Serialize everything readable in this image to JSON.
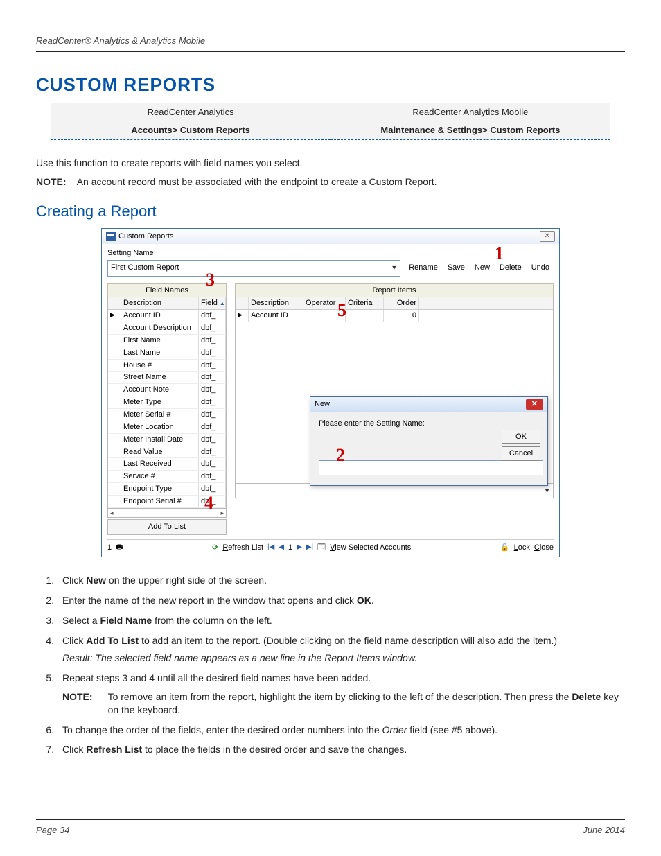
{
  "header": "ReadCenter® Analytics & Analytics Mobile",
  "title": "CUSTOM REPORTS",
  "navtable": {
    "h1": "ReadCenter Analytics",
    "h2": "ReadCenter Analytics Mobile",
    "p1": "Accounts> Custom Reports",
    "p2": "Maintenance & Settings> Custom Reports"
  },
  "intro": "Use this function to create reports with field names you select.",
  "note_label": "NOTE:",
  "note_text": "An account record must be associated with the endpoint to create a Custom Report.",
  "subtitle": "Creating a Report",
  "win": {
    "title": "Custom Reports",
    "close": "✕",
    "setting_label": "Setting Name",
    "setting_value": "First Custom Report",
    "buttons": {
      "rename": "Rename",
      "save": "Save",
      "new": "New",
      "delete": "Delete",
      "undo": "Undo"
    },
    "left_header": "Field Names",
    "right_header": "Report Items",
    "left_cols": {
      "desc": "Description",
      "field": "Field"
    },
    "left_rows": [
      {
        "d": "Account ID",
        "f": "dbf_"
      },
      {
        "d": "Account Description",
        "f": "dbf_"
      },
      {
        "d": "First Name",
        "f": "dbf_"
      },
      {
        "d": "Last Name",
        "f": "dbf_"
      },
      {
        "d": "House #",
        "f": "dbf_"
      },
      {
        "d": "Street Name",
        "f": "dbf_"
      },
      {
        "d": "Account Note",
        "f": "dbf_"
      },
      {
        "d": "Meter Type",
        "f": "dbf_"
      },
      {
        "d": "Meter Serial #",
        "f": "dbf_"
      },
      {
        "d": "Meter Location",
        "f": "dbf_"
      },
      {
        "d": "Meter Install Date",
        "f": "dbf_"
      },
      {
        "d": "Read Value",
        "f": "dbf_"
      },
      {
        "d": "Last Received",
        "f": "dbf_"
      },
      {
        "d": "Service #",
        "f": "dbf_"
      },
      {
        "d": "Endpoint Type",
        "f": "dbf_"
      },
      {
        "d": "Endpoint Serial #",
        "f": "dbf_"
      }
    ],
    "right_cols": {
      "desc": "Description",
      "op": "Operator",
      "crit": "Criteria",
      "ord": "Order"
    },
    "right_row": {
      "desc": "Account ID",
      "ord": "0"
    },
    "add": "Add To List",
    "refresh": "Refresh List",
    "page_num": "1",
    "view_sel": "View Selected Accounts",
    "lock": "Lock",
    "close_b": "Close"
  },
  "dlg": {
    "title": "New",
    "prompt": "Please enter the Setting Name:",
    "ok": "OK",
    "cancel": "Cancel"
  },
  "charms": {
    "c1": "1",
    "c2": "2",
    "c3": "3",
    "c4": "4",
    "c5": "5"
  },
  "steps": {
    "s1a": "Click ",
    "s1b": "New",
    "s1c": " on the upper right side of the screen.",
    "s2a": "Enter the name of the new report in the window that opens and click ",
    "s2b": "OK",
    "s2c": ".",
    "s3a": "Select a ",
    "s3b": "Field Name",
    "s3c": " from the column on the left.",
    "s4a": "Click ",
    "s4b": "Add To List",
    "s4c": " to add an item to the report. (Double clicking on the field name description will also add the item.)",
    "s4r": "Result: The selected field name appears as a new line in the Report Items window.",
    "s5": "Repeat steps 3 and 4 until all the desired field names have been added.",
    "s5n_a": "To remove an item from the report, highlight the item by clicking to the left of the description. Then press the ",
    "s5n_b": "Delete",
    "s5n_c": " key on the keyboard.",
    "s6a": "To change the order of the fields, enter the desired order numbers into the ",
    "s6b": "Order",
    "s6c": " field (see #5 above).",
    "s7a": "Click ",
    "s7b": "Refresh List",
    "s7c": " to place the fields in the desired order and save the changes."
  },
  "footer": {
    "page": "Page 34",
    "date": "June 2014"
  }
}
